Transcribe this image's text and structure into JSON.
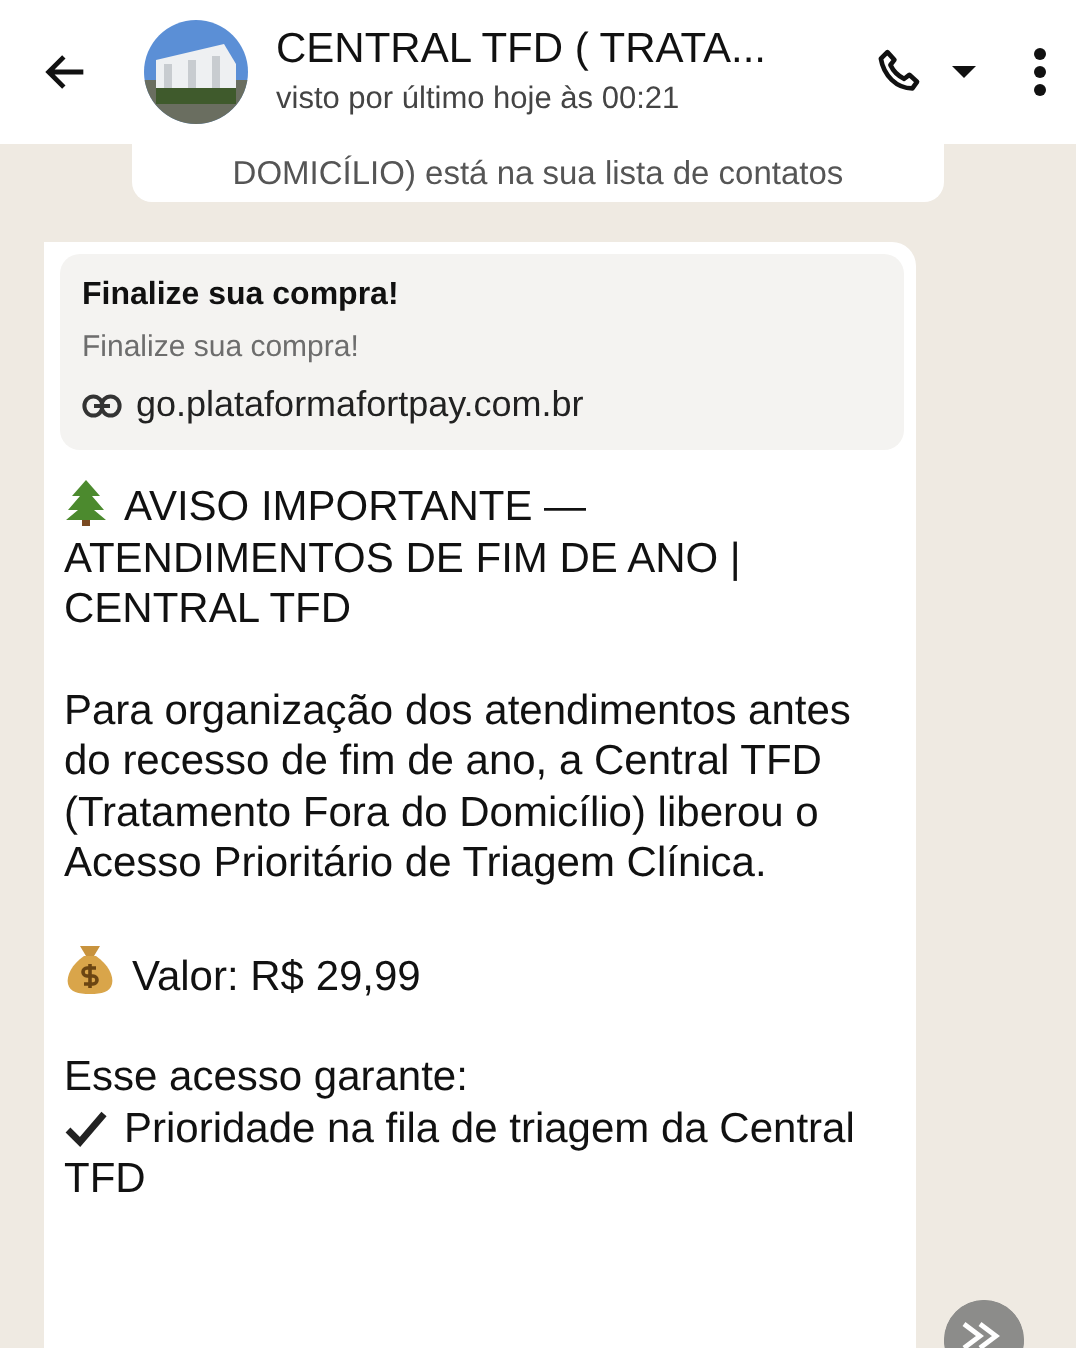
{
  "header": {
    "title": "CENTRAL TFD ( TRATA...",
    "status": "visto por último hoje às 00:21"
  },
  "notice": {
    "text": "DOMICÍLIO) está na sua lista de contatos"
  },
  "message": {
    "preview": {
      "title": "Finalize sua compra!",
      "description": "Finalize sua compra!",
      "domain": "go.plataformafortpay.com.br"
    },
    "paragraphs": [
      {
        "lines": [
          {
            "kind": "tree",
            "text": "AVISO IMPORTANTE — ATENDIMENTOS DE FIM DE ANO | CENTRAL TFD"
          }
        ]
      },
      {
        "lines": [
          {
            "kind": "plain",
            "text": "Para organização dos atendimentos antes do recesso de fim de ano, a Central TFD (Tratamento Fora do Domicílio) liberou o Acesso Prioritário de Triagem Clínica."
          }
        ]
      },
      {
        "lines": [
          {
            "kind": "money",
            "text": "Valor: R$ 29,99"
          }
        ]
      },
      {
        "lines": [
          {
            "kind": "plain",
            "text": "Esse acesso garante:"
          },
          {
            "kind": "check",
            "text": "Prioridade na fila de triagem da Central TFD"
          }
        ]
      }
    ]
  }
}
